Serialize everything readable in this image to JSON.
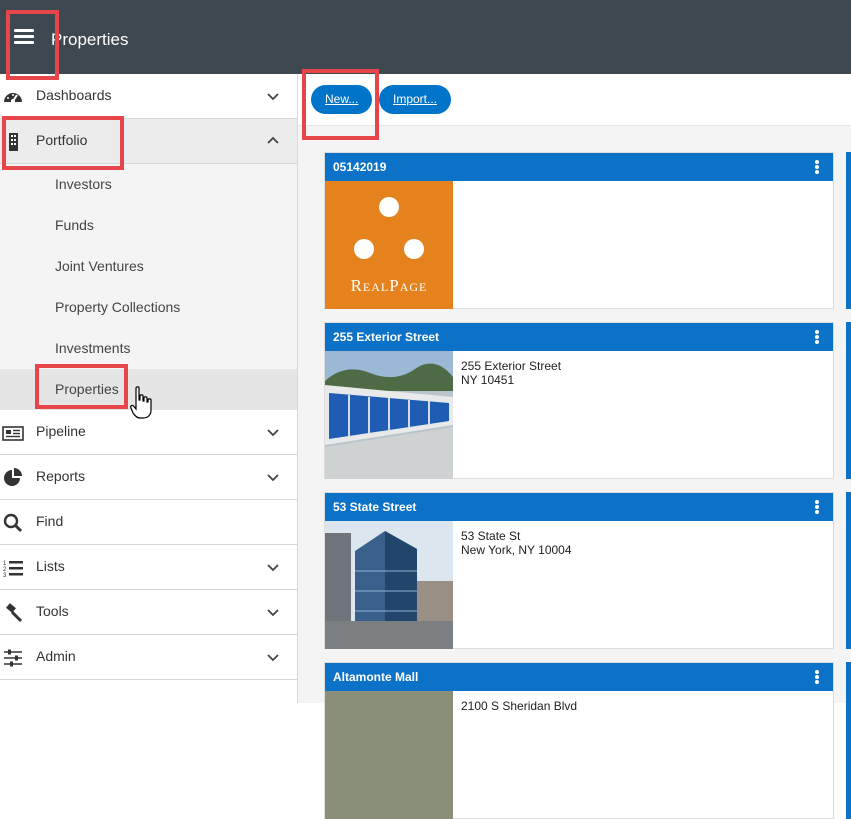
{
  "header": {
    "title": "Properties"
  },
  "sidebar": {
    "items": [
      {
        "label": "Dashboards",
        "icon": "dashboard-icon"
      },
      {
        "label": "Portfolio",
        "icon": "building-icon"
      },
      {
        "label": "Pipeline",
        "icon": "newspaper-icon"
      },
      {
        "label": "Reports",
        "icon": "pie-chart-icon"
      },
      {
        "label": "Find",
        "icon": "search-icon"
      },
      {
        "label": "Lists",
        "icon": "numbered-list-icon"
      },
      {
        "label": "Tools",
        "icon": "gavel-icon"
      },
      {
        "label": "Admin",
        "icon": "sliders-icon"
      }
    ],
    "portfolio_sub": [
      "Investors",
      "Funds",
      "Joint Ventures",
      "Property Collections",
      "Investments",
      "Properties"
    ]
  },
  "toolbar": {
    "new_label": "New...",
    "import_label": "Import..."
  },
  "cards": [
    {
      "title": "05142019",
      "address_line1": "",
      "address_line2": "",
      "logo_text": "RealPage"
    },
    {
      "title": "255 Exterior Street",
      "address_line1": "255 Exterior Street",
      "address_line2": "NY  10451"
    },
    {
      "title": "53 State Street",
      "address_line1": "53 State St",
      "address_line2": "New York, NY  10004"
    },
    {
      "title": "Altamonte Mall",
      "address_line1": "2100 S Sheridan Blvd",
      "address_line2": ""
    }
  ],
  "colors": {
    "header_bg": "#3d4850",
    "accent": "#0b72c7",
    "annotation": "#e8454a",
    "logo_bg": "#e5821e"
  }
}
